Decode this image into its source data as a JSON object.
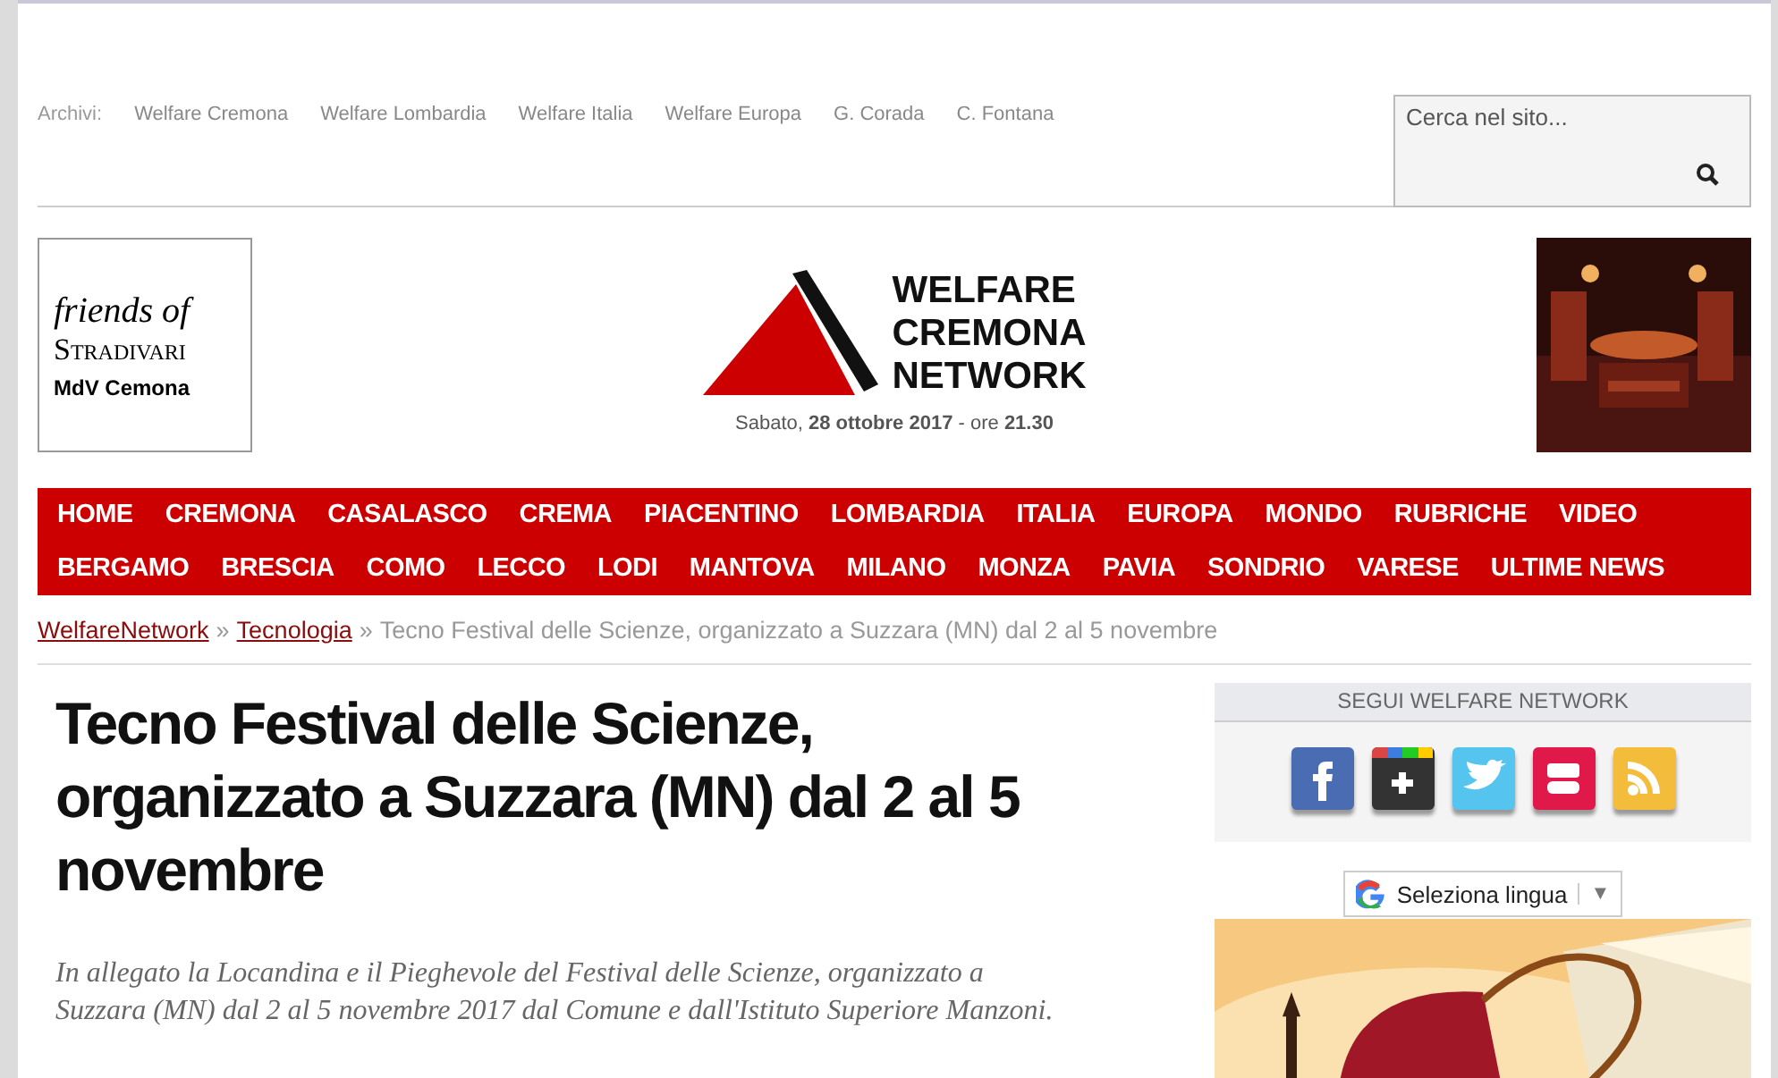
{
  "archive_bar": {
    "label": "Archivi:",
    "links": [
      "Welfare Cremona",
      "Welfare Lombardia",
      "Welfare Italia",
      "Welfare Europa",
      "G. Corada",
      "C. Fontana"
    ]
  },
  "search": {
    "placeholder": "Cerca nel sito..."
  },
  "left_banner": {
    "line_1": "friends of",
    "line_2": "Stradivari",
    "line_3": "MdV Cemona"
  },
  "right_banner": {
    "kind": "picture"
  },
  "logo": {
    "lines": [
      "WELFARE",
      "CREMONA",
      "NETWORK"
    ]
  },
  "date_line": "Sabato, **28 ottobre 2017** - ore **21.30**",
  "nav_rows": [
    [
      "HOME",
      "CREMONA",
      "CASALASCO",
      "CREMA",
      "PIACENTINO",
      "LOMBARDIA",
      "ITALIA",
      "EUROPA",
      "MONDO",
      "RUBRICHE",
      "VIDEO"
    ],
    [
      "BERGAMO",
      "BRESCIA",
      "COMO",
      "LECCO",
      "LODI",
      "MANTOVA",
      "MILANO",
      "MONZA",
      "PAVIA",
      "SONDRIO",
      "VARESE",
      "ULTIME NEWS"
    ]
  ],
  "breadcrumb": {
    "links": [
      "WelfareNetwork",
      "Tecnologia"
    ],
    "separator": "»",
    "current": "Tecno Festival delle Scienze, organizzato a Suzzara (MN) dal 2 al 5 novembre"
  },
  "article": {
    "title": "Tecno Festival delle Scienze, organizzato a Suzzara (MN) dal 2 al 5 novembre",
    "summary": "In allegato la Locandina e il Pieghevole del Festival delle Scienze, organizzato a Suzzara (MN) dal 2 al 5 novembre 2017 dal Comune e dall'Istituto Superiore Manzoni."
  },
  "sidebar": {
    "follow_title": "SEGUI WELFARE NETWORK",
    "social": [
      {
        "kind": "facebook",
        "color": "#4a6cb3"
      },
      {
        "kind": "plus",
        "color": "#333333"
      },
      {
        "kind": "bird",
        "color": "#55c5f0"
      },
      {
        "kind": "video",
        "color": "#e0194a"
      },
      {
        "kind": "rss",
        "color": "#f4bc3b"
      }
    ],
    "translate": {
      "label": "Seleziona lingua",
      "caret": "▼"
    },
    "banner": {
      "kind": "picture"
    }
  }
}
